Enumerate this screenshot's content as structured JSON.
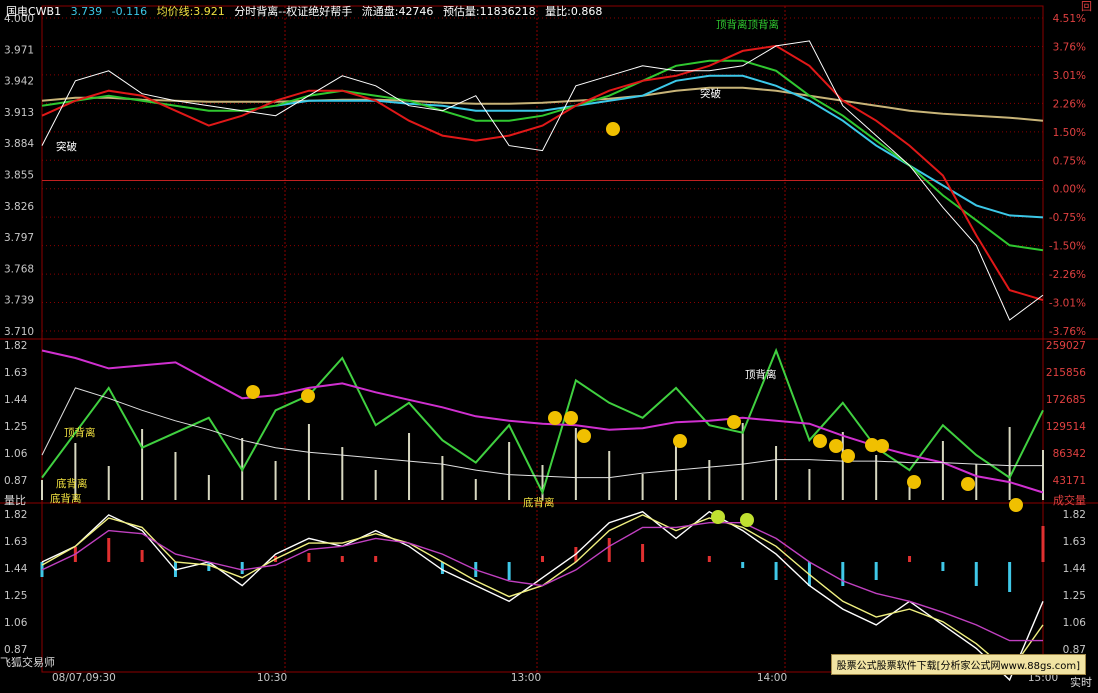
{
  "header": {
    "code": "国电CWB1",
    "price": "3.739",
    "change": "-0.116",
    "avg_label": "均价线:3.921",
    "indicator_name": "分时背离--权证绝好帮手",
    "float_label": "流通盘:42746",
    "est_volume": "预估量:11836218",
    "vol_ratio": "量比:0.868"
  },
  "corner_label": "回",
  "watermark": "股票公式股票软件下载[分析家公式网www.88gs.com]",
  "bottom_left_label": "飞狐交易师",
  "mid_left_label": "量比",
  "mid_right_label": "成交量",
  "bottom_right_label": "实时",
  "colors": {
    "price": "#ffffff",
    "ma_red": "#e01818",
    "ma_green": "#30c830",
    "ma_cyan": "#3cc8e8",
    "ma_avg": "#c8b478",
    "ratio_green": "#40d040",
    "ratio_magenta": "#d030d0",
    "grid": "#8b0000",
    "axis_text": "#c8c8c8",
    "axis_red": "#e04040",
    "signal": "#f0c000"
  },
  "chart_data": [
    {
      "type": "line",
      "panel": "price",
      "y_ticks": [
        "4.000",
        "3.971",
        "3.942",
        "3.913",
        "3.884",
        "3.855",
        "3.826",
        "3.797",
        "3.768",
        "3.739",
        "3.710"
      ],
      "y_ticks_right": [
        "4.51%",
        "3.76%",
        "3.01%",
        "2.26%",
        "1.50%",
        "0.75%",
        "0.00%",
        "-0.75%",
        "-1.50%",
        "-2.26%",
        "-3.01%",
        "-3.76%"
      ],
      "ylim": [
        3.7,
        4.03
      ],
      "prev_close": 3.855,
      "x": [
        0,
        8,
        16,
        24,
        32,
        40,
        48,
        56,
        64,
        72,
        80,
        88,
        96,
        104,
        112,
        120,
        128,
        136,
        144,
        152,
        160,
        168,
        176,
        184,
        192,
        200,
        208,
        216,
        224,
        232,
        240
      ],
      "series": [
        {
          "name": "price",
          "values": [
            3.89,
            3.955,
            3.965,
            3.942,
            3.935,
            3.93,
            3.925,
            3.92,
            3.94,
            3.96,
            3.95,
            3.93,
            3.925,
            3.94,
            3.89,
            3.885,
            3.95,
            3.96,
            3.97,
            3.965,
            3.965,
            3.97,
            3.99,
            3.995,
            3.93,
            3.9,
            3.87,
            3.828,
            3.79,
            3.715,
            3.74
          ]
        },
        {
          "name": "ma_red",
          "values": [
            3.92,
            3.935,
            3.945,
            3.94,
            3.925,
            3.91,
            3.92,
            3.935,
            3.945,
            3.945,
            3.935,
            3.915,
            3.9,
            3.895,
            3.9,
            3.91,
            3.93,
            3.945,
            3.955,
            3.96,
            3.97,
            3.985,
            3.99,
            3.97,
            3.935,
            3.915,
            3.89,
            3.86,
            3.8,
            3.745,
            3.735
          ]
        },
        {
          "name": "ma_green",
          "values": [
            3.93,
            3.935,
            3.94,
            3.935,
            3.93,
            3.925,
            3.925,
            3.93,
            3.94,
            3.945,
            3.94,
            3.935,
            3.925,
            3.915,
            3.915,
            3.92,
            3.93,
            3.94,
            3.955,
            3.97,
            3.975,
            3.975,
            3.965,
            3.94,
            3.92,
            3.895,
            3.87,
            3.84,
            3.815,
            3.79,
            3.785
          ]
        },
        {
          "name": "ma_cyan",
          "values": [
            null,
            null,
            null,
            null,
            null,
            null,
            null,
            3.93,
            3.935,
            3.935,
            3.935,
            3.932,
            3.93,
            3.925,
            3.925,
            3.925,
            3.93,
            3.935,
            3.94,
            3.955,
            3.96,
            3.96,
            3.95,
            3.935,
            3.915,
            3.89,
            3.87,
            3.85,
            3.83,
            3.82,
            3.818
          ]
        },
        {
          "name": "ma_avg",
          "values": [
            3.935,
            3.938,
            3.938,
            3.936,
            3.935,
            3.934,
            3.934,
            3.934,
            3.935,
            3.936,
            3.936,
            3.935,
            3.933,
            3.932,
            3.932,
            3.933,
            3.935,
            3.937,
            3.94,
            3.945,
            3.948,
            3.948,
            3.945,
            3.94,
            3.935,
            3.93,
            3.925,
            3.922,
            3.92,
            3.918,
            3.915
          ]
        }
      ],
      "annotations": [
        "突破",
        "突破",
        "顶背离顶背离"
      ]
    },
    {
      "type": "bar",
      "panel": "volume_ratio",
      "y_ticks": [
        "1.82",
        "1.63",
        "1.44",
        "1.25",
        "1.06",
        "0.87"
      ],
      "y_ticks_right": [
        "259027",
        "215856",
        "172685",
        "129514",
        "86342",
        "43171"
      ],
      "ylim": [
        0.8,
        1.85
      ],
      "x": [
        0,
        8,
        16,
        24,
        32,
        40,
        48,
        56,
        64,
        72,
        80,
        88,
        96,
        104,
        112,
        120,
        128,
        136,
        144,
        152,
        160,
        168,
        176,
        184,
        192,
        200,
        208,
        216,
        224,
        232,
        240
      ],
      "series": [
        {
          "name": "vol_ratio_green",
          "values": [
            0.95,
            1.25,
            1.55,
            1.15,
            1.25,
            1.35,
            1.0,
            1.4,
            1.5,
            1.75,
            1.3,
            1.45,
            1.2,
            1.05,
            1.3,
            0.85,
            1.6,
            1.45,
            1.35,
            1.55,
            1.3,
            1.25,
            1.8,
            1.2,
            1.45,
            1.15,
            1.0,
            1.3,
            1.1,
            0.95,
            1.4
          ]
        },
        {
          "name": "vol_ratio_magenta",
          "values": [
            1.8,
            1.75,
            1.68,
            1.7,
            1.72,
            1.6,
            1.48,
            1.5,
            1.55,
            1.58,
            1.52,
            1.47,
            1.42,
            1.36,
            1.33,
            1.31,
            1.3,
            1.27,
            1.28,
            1.32,
            1.33,
            1.35,
            1.33,
            1.31,
            1.23,
            1.16,
            1.1,
            1.05,
            0.96,
            0.92,
            0.85
          ]
        },
        {
          "name": "vol_ratio_white",
          "values": [
            1.1,
            1.55,
            1.48,
            1.4,
            1.33,
            1.27,
            1.2,
            1.15,
            1.12,
            1.1,
            1.08,
            1.06,
            1.04,
            1.0,
            0.97,
            0.96,
            0.95,
            0.95,
            0.98,
            1.0,
            1.02,
            1.04,
            1.07,
            1.07,
            1.06,
            1.06,
            1.05,
            1.05,
            1.04,
            1.03,
            1.03
          ]
        }
      ],
      "annotations": [
        "顶背离",
        "底背离",
        "顶背离",
        "底背离",
        "底背离"
      ]
    },
    {
      "type": "line",
      "panel": "oscillator",
      "y_ticks": [
        "1.82",
        "1.63",
        "1.44",
        "1.25",
        "1.06",
        "0.87"
      ],
      "ylim": [
        0.8,
        1.85
      ],
      "x": [
        0,
        8,
        16,
        24,
        32,
        40,
        48,
        56,
        64,
        72,
        80,
        88,
        96,
        104,
        112,
        120,
        128,
        136,
        144,
        152,
        160,
        168,
        176,
        184,
        192,
        200,
        208,
        216,
        224,
        232,
        240
      ],
      "series": [
        {
          "name": "osc_white",
          "values": [
            1.5,
            1.6,
            1.8,
            1.7,
            1.45,
            1.5,
            1.35,
            1.55,
            1.65,
            1.6,
            1.7,
            1.6,
            1.45,
            1.35,
            1.25,
            1.4,
            1.55,
            1.75,
            1.82,
            1.65,
            1.82,
            1.7,
            1.55,
            1.35,
            1.2,
            1.1,
            1.25,
            1.1,
            0.95,
            0.75,
            1.25
          ]
        },
        {
          "name": "osc_yellow",
          "values": [
            1.48,
            1.6,
            1.78,
            1.72,
            1.5,
            1.48,
            1.4,
            1.52,
            1.62,
            1.62,
            1.68,
            1.62,
            1.5,
            1.38,
            1.28,
            1.35,
            1.5,
            1.7,
            1.8,
            1.7,
            1.78,
            1.72,
            1.6,
            1.42,
            1.25,
            1.15,
            1.2,
            1.12,
            0.98,
            0.8,
            1.1
          ]
        },
        {
          "name": "osc_magenta",
          "values": [
            1.45,
            1.55,
            1.7,
            1.68,
            1.55,
            1.5,
            1.45,
            1.48,
            1.58,
            1.6,
            1.65,
            1.62,
            1.55,
            1.45,
            1.38,
            1.35,
            1.45,
            1.6,
            1.72,
            1.72,
            1.75,
            1.75,
            1.65,
            1.5,
            1.38,
            1.3,
            1.25,
            1.18,
            1.1,
            1.0,
            1.0
          ]
        },
        {
          "name": "osc_bar",
          "values": [
            -0.05,
            0.05,
            0.08,
            0.04,
            -0.05,
            -0.03,
            -0.04,
            0.02,
            0.03,
            0.02,
            0.02,
            0.0,
            -0.04,
            -0.05,
            -0.06,
            0.02,
            0.05,
            0.08,
            0.06,
            0.0,
            0.02,
            -0.02,
            -0.06,
            -0.08,
            -0.08,
            -0.06,
            0.02,
            -0.03,
            -0.08,
            -0.1,
            0.12
          ]
        }
      ]
    }
  ],
  "x_ticks": [
    "08/07,09:30",
    "10:30",
    "13:00",
    "14:00",
    "15:00"
  ]
}
